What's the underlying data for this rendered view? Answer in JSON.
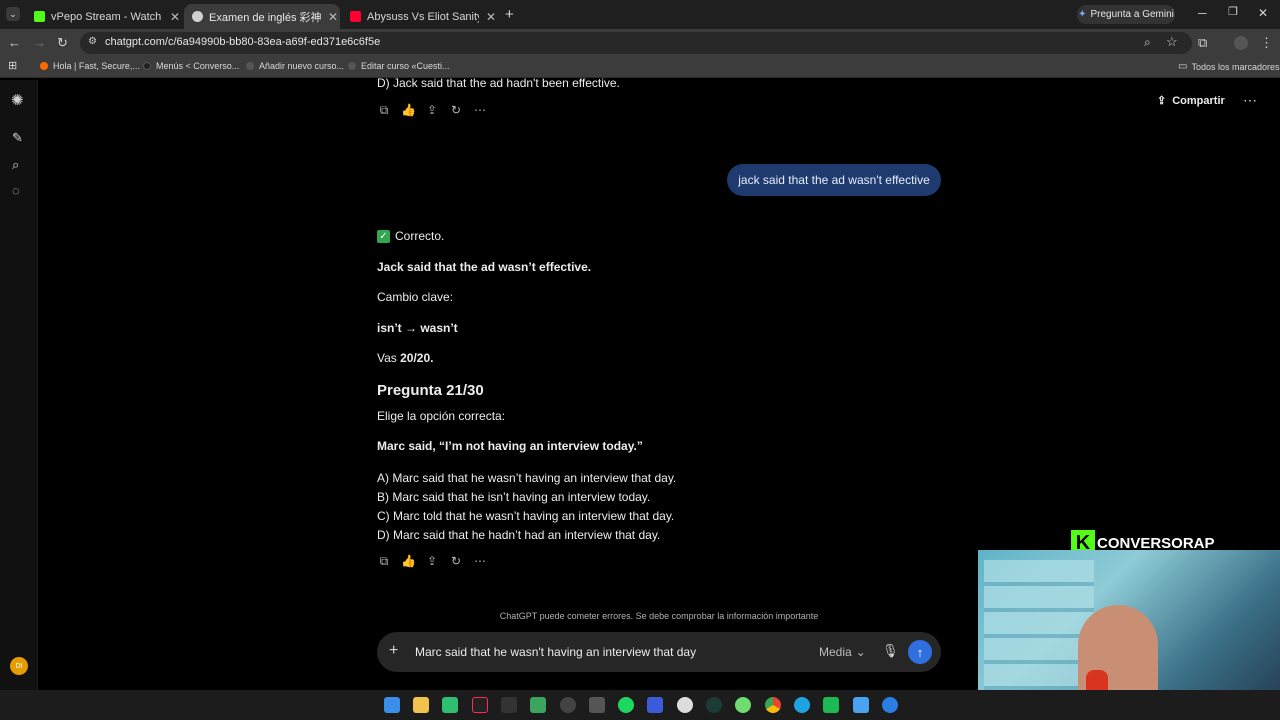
{
  "tabs": [
    {
      "title": "vPepo Stream - Watch Live on",
      "favicon_color": "#53fc18"
    },
    {
      "title": "Examen de inglés 彩神争霸快三",
      "favicon_color": "#d0d0d0"
    },
    {
      "title": "Abysuss Vs Eliot Sanity (SAYAYI",
      "favicon_color": "#ff0033"
    }
  ],
  "gemini_button": "Pregunta a Gemini",
  "url": "chatgpt.com/c/6a94990b-bb80-83ea-a69f-ed371e6c6f5e",
  "bookmarks": [
    {
      "label": "Hola | Fast, Secure,...",
      "color": "#ff6a00"
    },
    {
      "label": "Menús < Converso...",
      "color": "#333"
    },
    {
      "label": "Añadir nuevo curso...",
      "color": "#555"
    },
    {
      "label": "Editar curso «Cuesti...",
      "color": "#555"
    }
  ],
  "bookmarks_folder": "Todos los marcadores",
  "header": {
    "share_label": "Compartir"
  },
  "chat": {
    "prev_line": "D) Jack said that the ad hadn't been effective.",
    "user_message": "jack said that the ad wasn't effective",
    "correct_label": "Correcto.",
    "answer": "Jack said that the ad wasn’t effective.",
    "change_label": "Cambio clave:",
    "change_value": "isn’t → wasn’t",
    "score_prefix": "Vas ",
    "score": "20/20.",
    "question_title": "Pregunta 21/30",
    "instruction": "Elige la opción correcta:",
    "prompt": "Marc said, “I’m not having an interview today.”",
    "options": [
      "A) Marc said that he wasn’t having an interview that day.",
      "B) Marc said that he isn’t having an interview today.",
      "C) Marc told that he wasn’t having an interview that day.",
      "D) Marc said that he hadn’t had an interview that day."
    ]
  },
  "disclaimer": "ChatGPT puede cometer errores. Se debe comprobar la información importante",
  "composer": {
    "value": "Marc said that he wasn't having an interview that day",
    "model_label": "Media"
  },
  "overlay": {
    "brand": "CONVERSORAP"
  },
  "avatar_initials": "DI"
}
